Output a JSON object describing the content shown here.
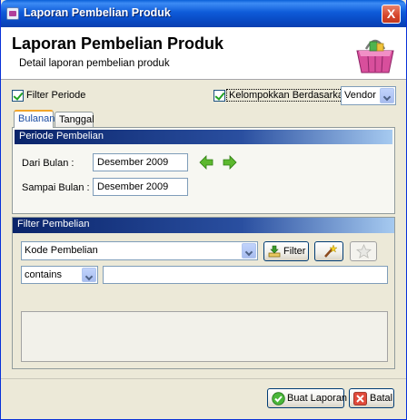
{
  "window": {
    "title": "Laporan Pembelian Produk",
    "close_label": "X"
  },
  "header": {
    "title": "Laporan Pembelian Produk",
    "subtitle": "Detail laporan pembelian produk"
  },
  "options": {
    "filter_periode_label": "Filter Periode",
    "filter_periode_checked": true,
    "group_by_label": "Kelompokkan Berdasarkan :",
    "group_by_checked": true,
    "group_by_value": "Vendor"
  },
  "tabs": [
    {
      "label": "Bulanan",
      "active": true
    },
    {
      "label": "Tanggal",
      "active": false
    }
  ],
  "periode": {
    "section_title": "Periode Pembelian",
    "from_label": "Dari Bulan :",
    "from_value": "Desember 2009",
    "to_label": "Sampai Bulan :",
    "to_value": "Desember 2009"
  },
  "filter": {
    "section_title": "Filter Pembelian",
    "field_value": "Kode Pembelian",
    "filter_button_label": "Filter",
    "operator_value": "contains",
    "search_value": ""
  },
  "footer": {
    "create_button_label": "Buat Laporan",
    "cancel_button_label": "Batal"
  },
  "colors": {
    "titlebar": "#0a5fd8",
    "section_header": "#0a246a",
    "tab_highlight": "#f2a52a"
  }
}
